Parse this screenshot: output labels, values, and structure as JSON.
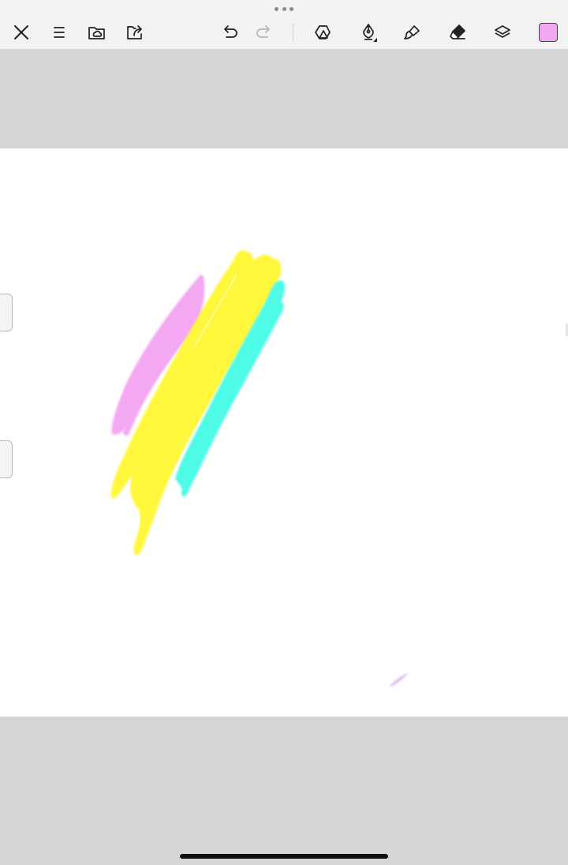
{
  "toolbar": {
    "tools": [
      {
        "name": "close",
        "icon": "close-icon"
      },
      {
        "name": "menu",
        "icon": "menu-icon"
      },
      {
        "name": "gallery",
        "icon": "folder-cloud-icon"
      },
      {
        "name": "export",
        "icon": "export-icon"
      },
      {
        "name": "undo",
        "icon": "undo-icon"
      },
      {
        "name": "redo",
        "icon": "redo-icon"
      },
      {
        "name": "shapes",
        "icon": "shapes-icon"
      },
      {
        "name": "pen",
        "icon": "pen-nib-icon"
      },
      {
        "name": "smudge",
        "icon": "brush-icon"
      },
      {
        "name": "eraser",
        "icon": "eraser-icon"
      },
      {
        "name": "layers",
        "icon": "layers-icon"
      }
    ],
    "current_color": "#f2a8f0"
  },
  "colors": {
    "toolbar_bg": "#f2f2f2",
    "workspace_bg": "#d5d5d7",
    "canvas_bg": "#ffffff",
    "icon": "#222222",
    "icon_disabled": "#b5b5b5"
  },
  "strokes": {
    "pink": "#f4a8f2",
    "yellow": "#fff73a",
    "cyan": "#4dfbe6",
    "lavender": "#d8b4f4"
  }
}
